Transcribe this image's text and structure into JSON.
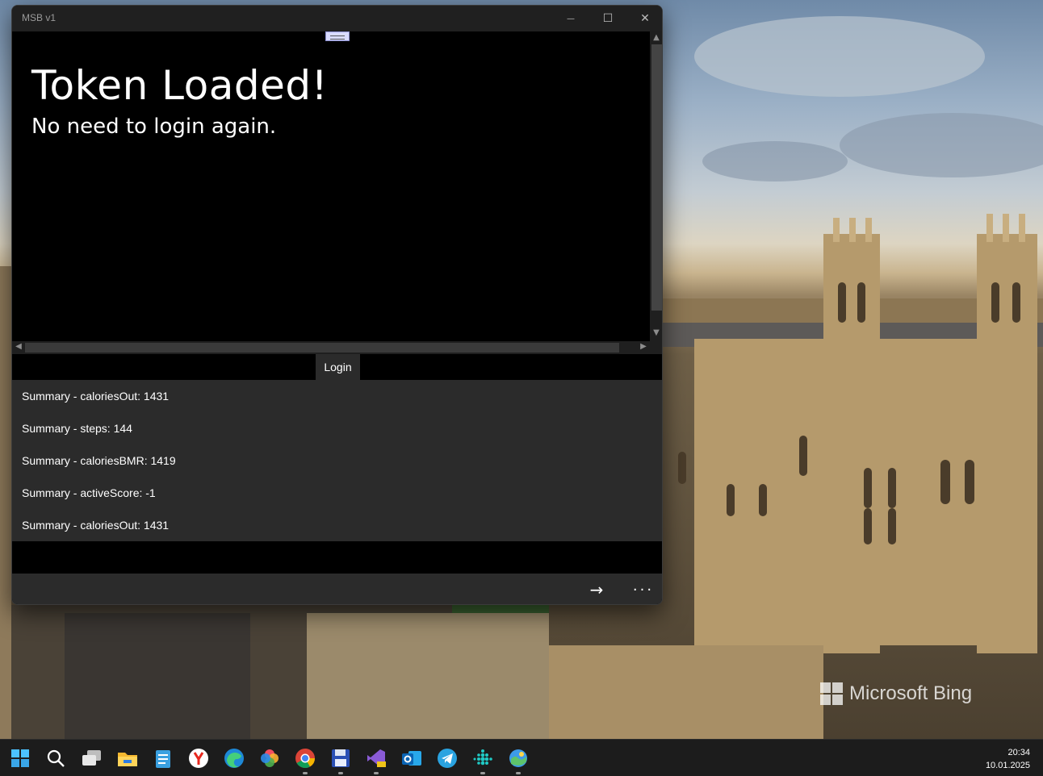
{
  "window": {
    "title": "MSB v1",
    "caption": {
      "minimize": "—",
      "maximize": "☐",
      "close": "✕"
    }
  },
  "webview": {
    "heading": "Token Loaded!",
    "subheading": "No need to login again."
  },
  "login_button": "Login",
  "summary_items": [
    "Summary - caloriesOut: 1431",
    "Summary - steps: 144",
    "Summary - caloriesBMR: 1419",
    "Summary - activeScore: -1",
    "Summary - caloriesOut: 1431"
  ],
  "command_bar": {
    "next_icon": "→",
    "more_icon": "···"
  },
  "desktop": {
    "watermark": "Microsoft Bing"
  },
  "taskbar": {
    "icons": [
      "start-icon",
      "search-icon",
      "task-view-icon",
      "file-explorer-icon",
      "notepad-icon",
      "yandex-browser-icon",
      "edge-icon",
      "photos-icon",
      "chrome-icon",
      "save-app-icon",
      "visual-studio-preview-icon",
      "outlook-icon",
      "telegram-icon",
      "fitbit-icon",
      "weather-icon"
    ],
    "time": "20:34",
    "date": "10.01.2025"
  }
}
